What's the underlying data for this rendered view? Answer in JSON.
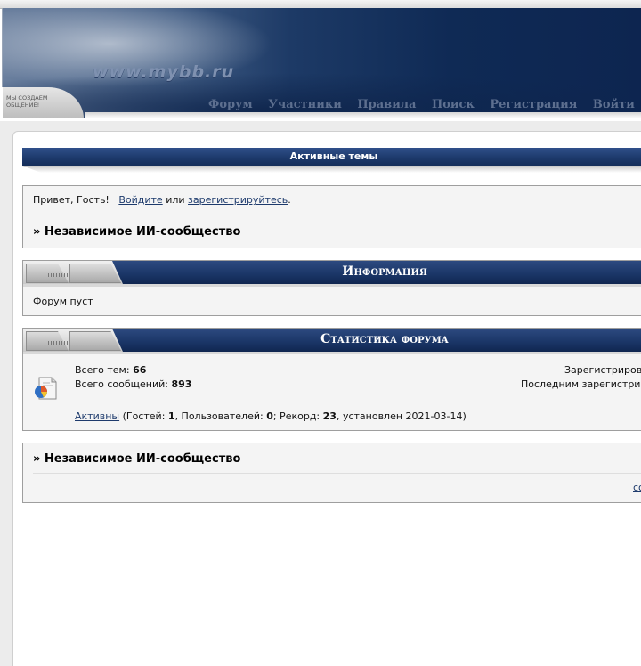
{
  "header": {
    "site_url": "www.mybb.ru",
    "slogan": "МЫ СОЗДАЕМ ОБЩЕНИЕ!",
    "nav": [
      "Форум",
      "Участники",
      "Правила",
      "Поиск",
      "Регистрация",
      "Войти"
    ]
  },
  "active_topics": {
    "label": "Активные темы"
  },
  "welcome": {
    "greeting": "Привет, Гость!",
    "login_link": "Войдите",
    "or": "или",
    "register_link": "зарегистрируйтесь",
    "dot": ".",
    "forum_title": "» Независимое ИИ-сообщество"
  },
  "info": {
    "title": "Информация",
    "text": "Форум пуст"
  },
  "stats": {
    "title": "Статистика форума",
    "topics_label": "Всего тем:",
    "topics_value": "66",
    "posts_label": "Всего сообщений:",
    "posts_value": "893",
    "registered_label": "Зарегистриров",
    "last_registered_label": "Последним зарегистрир",
    "active_link": "Активны",
    "online_guests_label": " (Гостей: ",
    "online_guests": "1",
    "online_users_label": ", Пользователей: ",
    "online_users": "0",
    "record_label": "; Рекорд: ",
    "record_value": "23",
    "record_date_label": ", установлен 2021-03-14)"
  },
  "footer": {
    "forum_title": "» Независимое ИИ-сообщество",
    "right_link": "со"
  },
  "colors": {
    "accent": "#1d3a6c",
    "nav_text": "#5d6f8f",
    "panel_bg": "#f4f4f4"
  }
}
